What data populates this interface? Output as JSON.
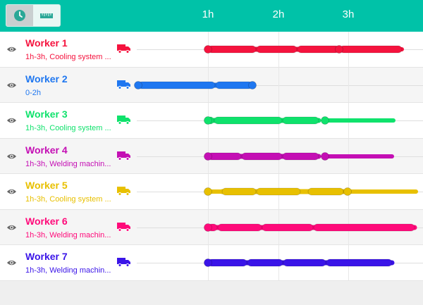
{
  "header": {
    "toggles": [
      {
        "name": "clock-view",
        "icon": "clock-icon",
        "active": true
      },
      {
        "name": "ruler-view",
        "icon": "ruler-icon",
        "active": false
      }
    ],
    "time_labels": [
      "1h",
      "2h",
      "3h"
    ]
  },
  "colors": {
    "header_bg": "#00c2a8",
    "workers": [
      "#f5133e",
      "#1f77f0",
      "#0fe26c",
      "#c40fb4",
      "#e8c000",
      "#ff0a7a",
      "#3a14e8"
    ]
  },
  "workers": [
    {
      "name": "Worker 1",
      "detail": "1h-3h, Cooling system ...",
      "color": "#f5133e"
    },
    {
      "name": "Worker 2",
      "detail": "0-2h",
      "color": "#1f77f0"
    },
    {
      "name": "Worker 3",
      "detail": "1h-3h, Cooling system ...",
      "color": "#0fe26c"
    },
    {
      "name": "Worker 4",
      "detail": "1h-3h, Welding machin...",
      "color": "#c40fb4"
    },
    {
      "name": "Worker 5",
      "detail": "1h-3h, Cooling system ...",
      "color": "#e8c000"
    },
    {
      "name": "Worker 6",
      "detail": "1h-3h, Welding machin...",
      "color": "#ff0a7a"
    },
    {
      "name": "Worker 7",
      "detail": "1h-3h, Welding machin...",
      "color": "#3a14e8"
    }
  ]
}
